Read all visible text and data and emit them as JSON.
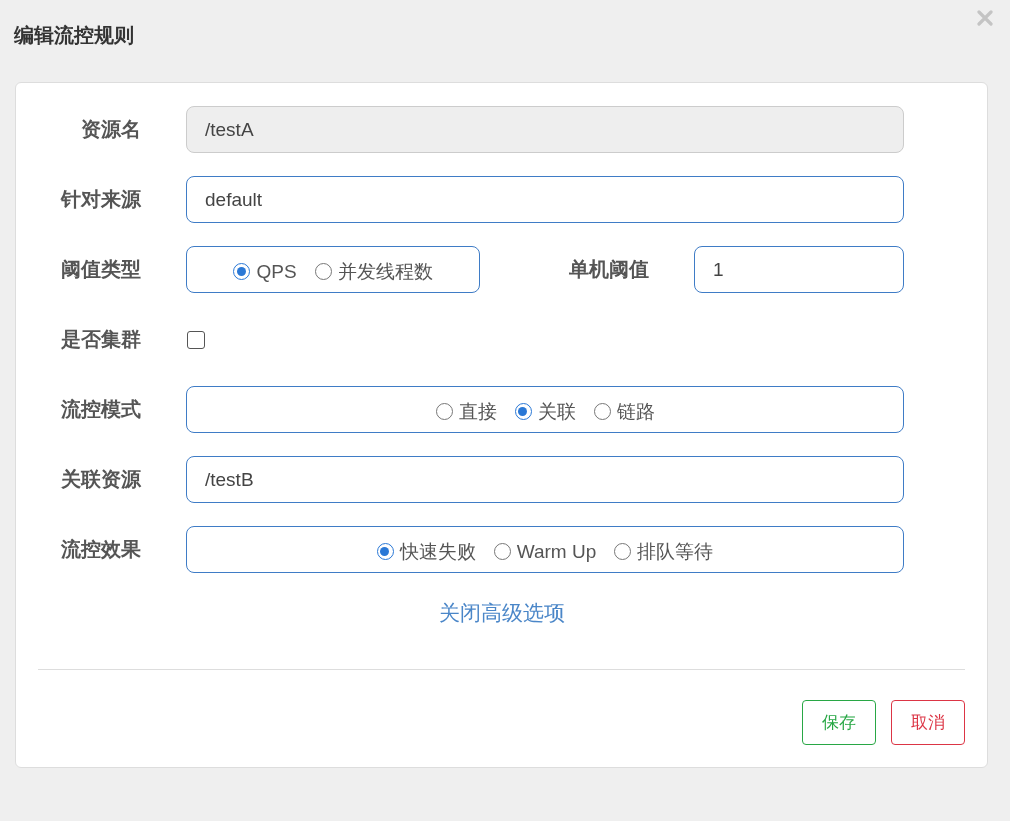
{
  "dialog": {
    "title": "编辑流控规则"
  },
  "rows": [
    {
      "kind": "field",
      "label": "资源名",
      "value": "/testA",
      "disabled": true
    },
    {
      "kind": "field",
      "label": "针对来源",
      "value": "default",
      "disabled": false
    },
    {
      "kind": "radio",
      "label": "阈值类型",
      "options": [
        {
          "label": "QPS",
          "selected": true
        },
        {
          "label": "并发线程数",
          "selected": false
        }
      ],
      "side": {
        "label": "单机阈值",
        "value": "1"
      }
    },
    {
      "kind": "checkbox",
      "label": "是否集群",
      "checked": false
    },
    {
      "kind": "radio",
      "label": "流控模式",
      "options": [
        {
          "label": "直接",
          "selected": false
        },
        {
          "label": "关联",
          "selected": true
        },
        {
          "label": "链路",
          "selected": false
        }
      ]
    },
    {
      "kind": "field",
      "label": "关联资源",
      "value": "/testB",
      "disabled": false
    },
    {
      "kind": "radio",
      "label": "流控效果",
      "options": [
        {
          "label": "快速失败",
          "selected": true
        },
        {
          "label": "Warm Up",
          "selected": false
        },
        {
          "label": "排队等待",
          "selected": false
        }
      ]
    }
  ],
  "link": "关闭高级选项",
  "buttons": [
    {
      "label": "保存",
      "kind": "save"
    },
    {
      "label": "取消",
      "kind": "cancel"
    }
  ]
}
